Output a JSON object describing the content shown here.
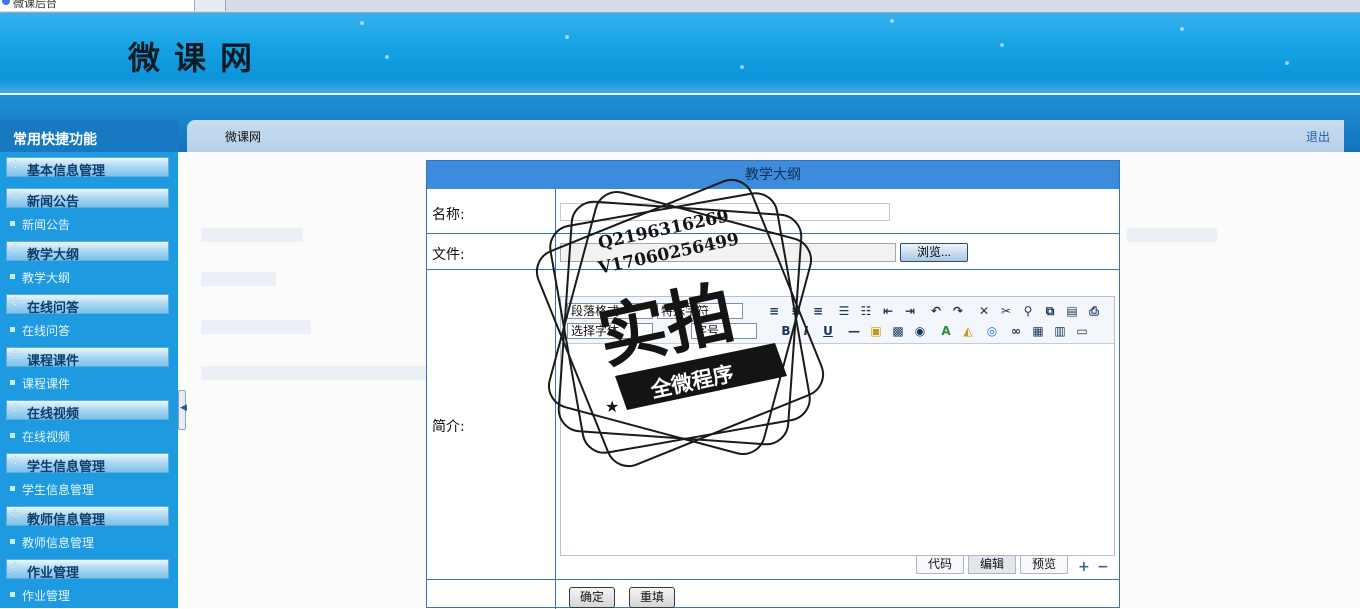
{
  "browser": {
    "tab_title": "微课后台"
  },
  "header": {
    "site_name": "微课网"
  },
  "sidebar": {
    "title": "常用快捷功能",
    "groups": [
      {
        "title": "基本信息管理",
        "links": []
      },
      {
        "title": "新闻公告",
        "links": [
          "新闻公告"
        ]
      },
      {
        "title": "教学大纲",
        "links": [
          "教学大纲"
        ]
      },
      {
        "title": "在线问答",
        "links": [
          "在线问答"
        ]
      },
      {
        "title": "课程课件",
        "links": [
          "课程课件"
        ]
      },
      {
        "title": "在线视频",
        "links": [
          "在线视频"
        ]
      },
      {
        "title": "学生信息管理",
        "links": [
          "学生信息管理"
        ]
      },
      {
        "title": "教师信息管理",
        "links": [
          "教师信息管理"
        ]
      },
      {
        "title": "作业管理",
        "links": [
          "作业管理"
        ]
      }
    ]
  },
  "topbar": {
    "breadcrumb": "微课网",
    "logout": "退出"
  },
  "form": {
    "title": "教学大纲",
    "name_label": "名称:",
    "name_value": "",
    "file_label": "文件:",
    "file_value": "",
    "browse_label": "浏览...",
    "intro_label": "简介:",
    "editor": {
      "paragraph_select": "段落格式",
      "special_select": "特殊字符",
      "font_select": "选择字体",
      "size_select": "字号",
      "modes": [
        "代码",
        "编辑",
        "预览"
      ],
      "active_mode": "编辑"
    },
    "submit_label": "确定",
    "reset_label": "重填"
  },
  "watermark": {
    "line1": "Q2196316269",
    "line2": "V17060256499",
    "big": "实拍",
    "ribbon": "全微程序"
  },
  "colors": {
    "banner": "#14a1e3",
    "sidebar": "#1d9ae0",
    "form_header": "#3d8bdc",
    "border": "#3a73b5"
  }
}
